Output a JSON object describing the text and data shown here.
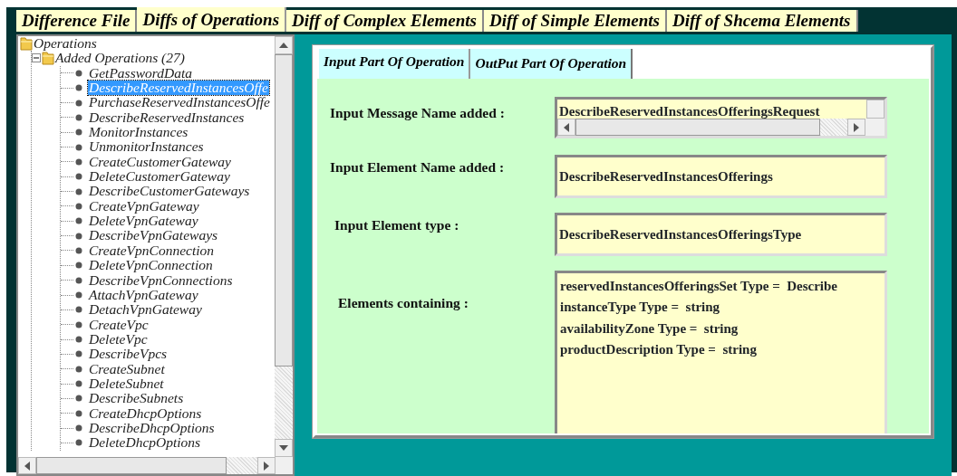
{
  "top_tabs": [
    {
      "label": "Difference File",
      "selected": false
    },
    {
      "label": "Diffs of Operations",
      "selected": true
    },
    {
      "label": "Diff of Complex Elements",
      "selected": false
    },
    {
      "label": "Diff of Simple Elements",
      "selected": false
    },
    {
      "label": "Diff of Shcema Elements",
      "selected": false
    }
  ],
  "tree": {
    "label": "Operations",
    "children": [
      {
        "label": "Added Operations (27)",
        "expanded": true,
        "children": [
          {
            "label": "GetPasswordData",
            "selected": false
          },
          {
            "label": "DescribeReservedInstancesOffe",
            "selected": true
          },
          {
            "label": "PurchaseReservedInstancesOffe",
            "selected": false
          },
          {
            "label": "DescribeReservedInstances",
            "selected": false
          },
          {
            "label": "MonitorInstances",
            "selected": false
          },
          {
            "label": "UnmonitorInstances",
            "selected": false
          },
          {
            "label": "CreateCustomerGateway",
            "selected": false
          },
          {
            "label": "DeleteCustomerGateway",
            "selected": false
          },
          {
            "label": "DescribeCustomerGateways",
            "selected": false
          },
          {
            "label": "CreateVpnGateway",
            "selected": false
          },
          {
            "label": "DeleteVpnGateway",
            "selected": false
          },
          {
            "label": "DescribeVpnGateways",
            "selected": false
          },
          {
            "label": "CreateVpnConnection",
            "selected": false
          },
          {
            "label": "DeleteVpnConnection",
            "selected": false
          },
          {
            "label": "DescribeVpnConnections",
            "selected": false
          },
          {
            "label": "AttachVpnGateway",
            "selected": false
          },
          {
            "label": "DetachVpnGateway",
            "selected": false
          },
          {
            "label": "CreateVpc",
            "selected": false
          },
          {
            "label": "DeleteVpc",
            "selected": false
          },
          {
            "label": "DescribeVpcs",
            "selected": false
          },
          {
            "label": "CreateSubnet",
            "selected": false
          },
          {
            "label": "DeleteSubnet",
            "selected": false
          },
          {
            "label": "DescribeSubnets",
            "selected": false
          },
          {
            "label": "CreateDhcpOptions",
            "selected": false
          },
          {
            "label": "DescribeDhcpOptions",
            "selected": false
          },
          {
            "label": "DeleteDhcpOptions",
            "selected": false
          }
        ]
      }
    ]
  },
  "operation_tabs": [
    {
      "label": "Input Part Of Operation",
      "selected": true
    },
    {
      "label": "OutPut Part Of Operation",
      "selected": false
    }
  ],
  "fields": [
    {
      "kind": "scroll",
      "label": "Input Message Name added :",
      "value": "DescribeReservedInstancesOfferingsRequest"
    },
    {
      "kind": "text",
      "label": "Input Element Name added :",
      "value": "DescribeReservedInstancesOfferings"
    },
    {
      "kind": "text",
      "label": "Input Element type :",
      "value": "DescribeReservedInstancesOfferingsType"
    },
    {
      "kind": "multiline",
      "label": "Elements containing :",
      "lines": [
        "reservedInstancesOfferingsSet Type =  Describe",
        "instanceType Type =  string",
        "availabilityZone Type =  string",
        "productDescription Type =  string"
      ]
    }
  ]
}
